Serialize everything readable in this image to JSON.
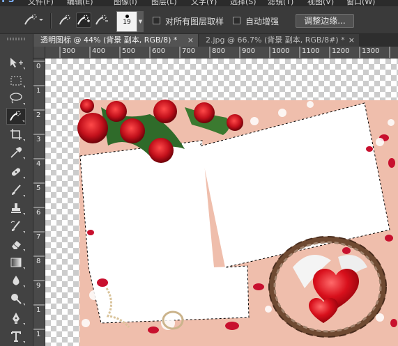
{
  "menubar": {
    "app_logo": "Ps",
    "items": [
      "文件(F)",
      "编辑(E)",
      "图像(I)",
      "图层(L)",
      "文字(Y)",
      "选择(S)",
      "滤镜(T)",
      "视图(V)",
      "窗口(W)"
    ]
  },
  "options_bar": {
    "brush_size": "19",
    "sample_all_layers_label": "对所有图层取样",
    "sample_all_layers_checked": false,
    "auto_enhance_label": "自动增强",
    "auto_enhance_checked": false,
    "refine_edge_label": "调整边缘..."
  },
  "tabs": [
    {
      "label": "透明图标 @ 44% (背景 副本, RGB/8) *",
      "close": "×",
      "active": true
    },
    {
      "label": "2.jpg @ 66.7% (背景 副本, RGB/8#) *",
      "close": "×",
      "active": false
    }
  ],
  "ruler": {
    "horizontal": [
      "300",
      "400",
      "500",
      "600",
      "700",
      "800",
      "900",
      "1000",
      "1100",
      "1200",
      "1300"
    ],
    "vertical": [
      "0",
      "1",
      "2",
      "3",
      "4",
      "5",
      "6",
      "7",
      "8",
      "9",
      "1",
      "1"
    ]
  },
  "tools": [
    "move-tool",
    "marquee-tool",
    "lasso-tool",
    "quick-selection-tool",
    "crop-tool",
    "eyedropper-tool",
    "healing-brush-tool",
    "brush-tool",
    "clone-stamp-tool",
    "history-brush-tool",
    "eraser-tool",
    "gradient-tool",
    "blur-tool",
    "dodge-tool",
    "pen-tool",
    "type-tool"
  ],
  "colors": {
    "accent_red": "#c8102e",
    "canvas_peach": "#f2c3b0",
    "ui_dark": "#3a3a3a"
  }
}
